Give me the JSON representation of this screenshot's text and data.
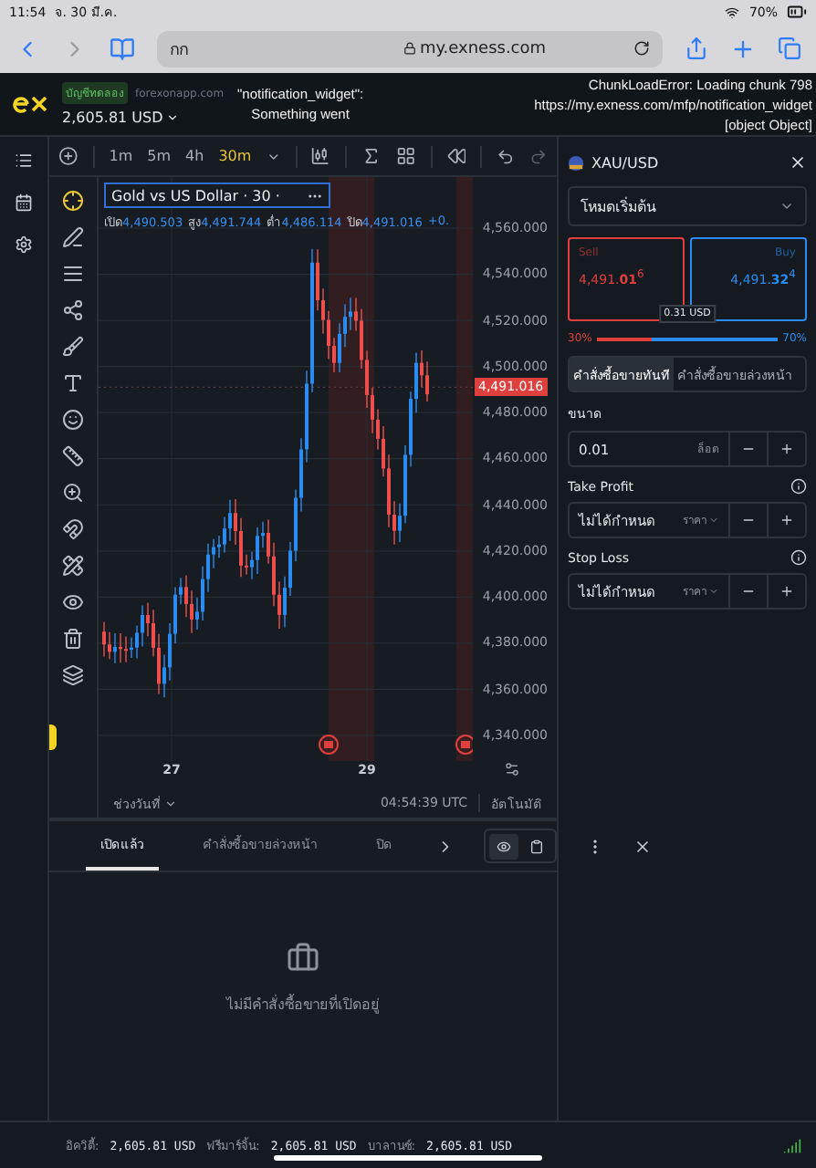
{
  "status_bar": {
    "time": "11:54",
    "date": "จ. 30 มี.ค.",
    "battery": "70%"
  },
  "browser": {
    "address_left": "กก",
    "url": "my.exness.com"
  },
  "header": {
    "account_type": "บัญชีทดลอง",
    "domain": "forexonapp.com",
    "balance": "2,605.81 USD",
    "error_left": [
      "\"notification_widget\":",
      "Something went"
    ],
    "error_right": [
      "ChunkLoadError: Loading chunk 798",
      "https://my.exness.com/mfp/notification_widget",
      "[object Object]"
    ]
  },
  "chart": {
    "timeframes": [
      {
        "label": "1m",
        "selected": false
      },
      {
        "label": "5m",
        "selected": false
      },
      {
        "label": "4h",
        "selected": false
      },
      {
        "label": "30m",
        "selected": true
      }
    ],
    "symbol_title": "Gold vs US Dollar · 30 ·",
    "ohlc": [
      {
        "label": "เปิด",
        "value": "4,490.503"
      },
      {
        "label": "สูง",
        "value": "4,491.744"
      },
      {
        "label": "ต่ำ",
        "value": "4,486.114"
      },
      {
        "label": "ปิด",
        "value": "4,491.016"
      }
    ],
    "change": "+0.",
    "price_labels": [
      "4,560.000",
      "4,540.000",
      "4,520.000",
      "4,500.000",
      "4,480.000",
      "4,460.000",
      "4,440.000",
      "4,420.000",
      "4,400.000",
      "4,380.000",
      "4,360.000",
      "4,340.000"
    ],
    "current_price": "4,491.016",
    "time_labels": [
      "27",
      "29"
    ],
    "date_range": "ช่วงวันที่",
    "clock": "04:54:39 UTC",
    "auto_scale": "อัตโนมัติ"
  },
  "positions": {
    "tabs": [
      {
        "label": "เปิดแล้ว",
        "selected": true
      },
      {
        "label": "คำสั่งซื้อขายล่วงหน้า",
        "selected": false
      },
      {
        "label": "ปิด",
        "selected": false
      }
    ],
    "empty_message": "ไม่มีคำสั่งซื้อขายที่เปิดอยู่"
  },
  "footer": [
    {
      "label": "อิควิตี้:",
      "value": "2,605.81 USD"
    },
    {
      "label": "ฟรีมาร์จิ้น:",
      "value": "2,605.81 USD"
    },
    {
      "label": "บาลานซ์:",
      "value": "2,605.81 USD"
    }
  ],
  "order_panel": {
    "symbol": "XAU/USD",
    "mode": "โหมดเริ่มต้น",
    "sides": [
      {
        "kind": "sell",
        "label": "Sell",
        "price": "4,491.**01**$^{6}$"
      },
      {
        "kind": "buy",
        "label": "Buy",
        "price": "4,491.**32**$^{4}$"
      }
    ],
    "spread": "0.31 USD",
    "sell_share": "30%",
    "buy_share": "70%",
    "level": 0.3,
    "order_types": [
      {
        "label": "คำสั่งซื้อขายทันที",
        "selected": true
      },
      {
        "label": "คำสั่งซื้อขายล่วงหน้า",
        "selected": false
      }
    ],
    "volume": {
      "label": "ขนาด",
      "value": "0.01",
      "unit": "ล็อต"
    },
    "stops": [
      {
        "label": "Take Profit",
        "value": "ไม่ได้กำหนด",
        "unit": "ราคา"
      },
      {
        "label": "Stop Loss",
        "value": "ไม่ได้กำหนด",
        "unit": "ราคา"
      }
    ]
  }
}
